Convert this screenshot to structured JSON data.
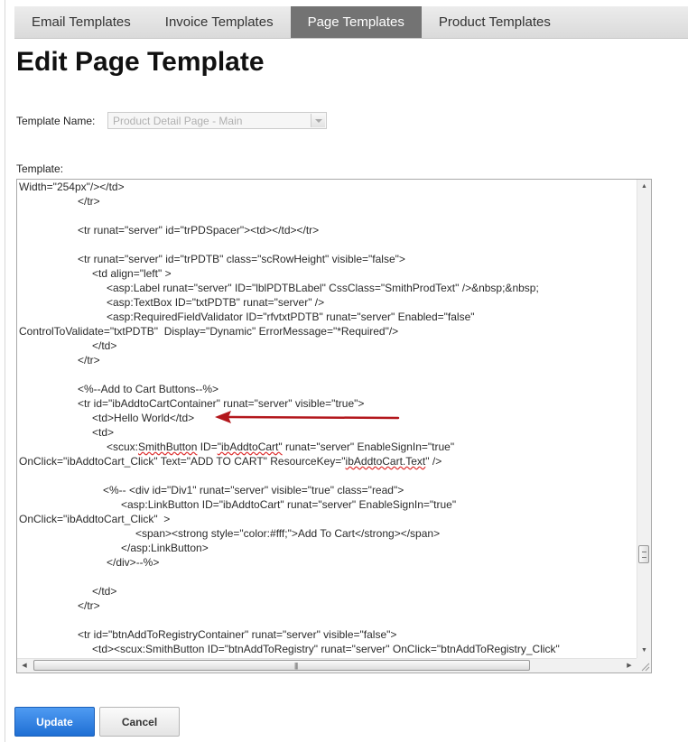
{
  "tabs": [
    {
      "label": "Email Templates"
    },
    {
      "label": "Invoice Templates"
    },
    {
      "label": "Page Templates",
      "active": true
    },
    {
      "label": "Product Templates"
    }
  ],
  "page_title": "Edit Page Template",
  "template_name": {
    "label": "Template Name:",
    "value": "Product Detail Page - Main"
  },
  "template": {
    "label": "Template:",
    "lines": [
      "Width=\"254px\"/></td>",
      "</tr>",
      "<tr runat=\"server\" id=\"trPDSpacer\"><td></td></tr>",
      "<tr runat=\"server\" id=\"trPDTB\" class=\"scRowHeight\" visible=\"false\">",
      "<td align=\"left\" >",
      "<asp:Label runat=\"server\" ID=\"lblPDTBLabel\" CssClass=\"SmithProdText\" />&nbsp;&nbsp;",
      "<asp:TextBox ID=\"txtPDTB\" runat=\"server\" />",
      "<asp:RequiredFieldValidator ID=\"rfvtxtPDTB\" runat=\"server\" Enabled=\"false\"",
      "ControlToValidate=\"txtPDTB\"  Display=\"Dynamic\" ErrorMessage=\"*Required\"/>",
      "</td>",
      "</tr>",
      "<%--Add to Cart Buttons--%>",
      "<tr id=\"ibAddtoCartContainer\" runat=\"server\" visible=\"true\">",
      "<td>Hello World</td>",
      "<td>",
      "<scux:SmithButton ID=\"ibAddtoCart\" runat=\"server\" EnableSignIn=\"true\"",
      "OnClick=\"ibAddtoCart_Click\" Text=\"ADD TO CART\" ResourceKey=\"ibAddtoCart.Text\" />",
      "<%-- <div id=\"Div1\" runat=\"server\" visible=\"true\" class=\"read\">",
      "<asp:LinkButton ID=\"ibAddtoCart\" runat=\"server\" EnableSignIn=\"true\"",
      "OnClick=\"ibAddtoCart_Click\"  >",
      "<span><strong style=\"color:#fff;\">Add To Cart</strong></span>",
      "</asp:LinkButton>",
      "</div>--%>",
      "</td>",
      "</tr>",
      "<tr id=\"btnAddToRegistryContainer\" runat=\"server\" visible=\"false\">",
      "<td><scux:SmithButton ID=\"btnAddToRegistry\" runat=\"server\" OnClick=\"btnAddToRegistry_Click\""
    ]
  },
  "buttons": {
    "update": "Update",
    "cancel": "Cancel"
  },
  "colors": {
    "active_tab": "#737373",
    "primary_button": "#2a7ae2",
    "annotation_arrow": "#b3171c"
  }
}
